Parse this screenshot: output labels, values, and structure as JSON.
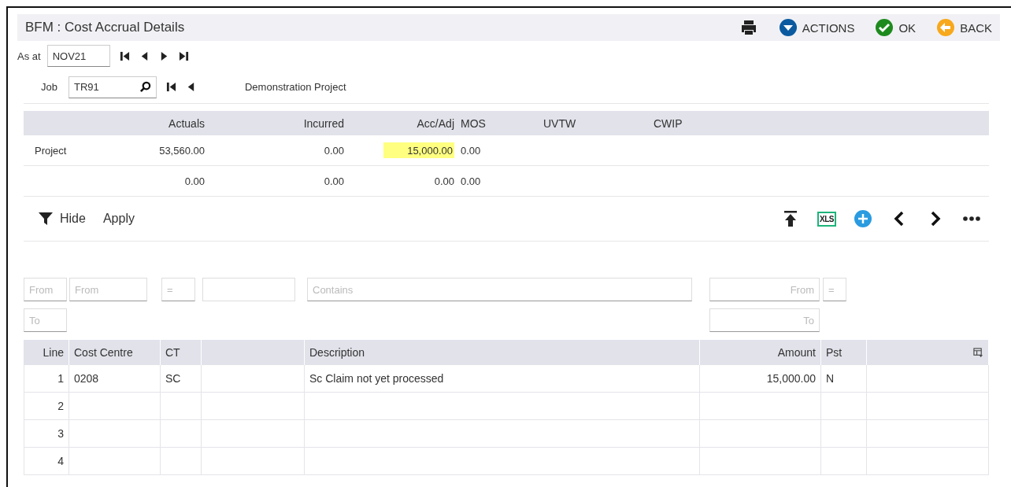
{
  "window": {
    "title": "BFM : Cost Accrual Details"
  },
  "header_actions": [
    {
      "kind": "print"
    },
    {
      "kind": "actions",
      "label": "ACTIONS"
    },
    {
      "kind": "ok",
      "label": "OK"
    },
    {
      "kind": "back",
      "label": "BACK"
    }
  ],
  "as_at": {
    "label": "As at",
    "value": "NOV21",
    "nav": [
      {
        "kind": "first"
      },
      {
        "kind": "prev"
      },
      {
        "kind": "next"
      },
      {
        "kind": "last"
      }
    ]
  },
  "job": {
    "label": "Job",
    "value": "TR91",
    "nav": [
      {
        "kind": "first"
      },
      {
        "kind": "prev"
      }
    ],
    "description": "Demonstration Project"
  },
  "summary": {
    "columns": [
      "Actuals",
      "Incurred",
      "Acc/Adj",
      "MOS",
      "UVTW",
      "CWIP"
    ],
    "rows": [
      {
        "label": "Project",
        "cells": [
          {
            "value": "53,560.00",
            "highlighted": false
          },
          {
            "value": "0.00",
            "highlighted": false
          },
          {
            "value": "15,000.00",
            "highlighted": true
          },
          {
            "value": "0.00",
            "highlighted": false
          }
        ]
      },
      {
        "cells": [
          {
            "value": "0.00",
            "highlighted": false
          },
          {
            "value": "0.00",
            "highlighted": false
          },
          {
            "value": "0.00",
            "highlighted": false
          },
          {
            "value": "0.00",
            "highlighted": false
          }
        ]
      }
    ]
  },
  "grid_toolbar": {
    "filter_toggle": "Hide",
    "apply": "Apply",
    "tools": [
      {
        "kind": "top"
      },
      {
        "kind": "xls",
        "label": "XLS"
      },
      {
        "kind": "add"
      },
      {
        "kind": "prev"
      },
      {
        "kind": "next"
      },
      {
        "kind": "more"
      }
    ]
  },
  "table": {
    "columns": [
      {
        "kind": "line",
        "label": "Line",
        "filters": [
          {
            "placeholder": "From"
          },
          {
            "placeholder": "To"
          }
        ]
      },
      {
        "kind": "text",
        "label": "Cost Centre",
        "filters": [
          {
            "placeholder": "From"
          }
        ]
      },
      {
        "kind": "text",
        "label": "CT",
        "filters": [
          {
            "placeholder": "="
          }
        ]
      },
      {
        "kind": "text",
        "filters": [
          {
            "kind": "blank"
          }
        ]
      },
      {
        "kind": "text",
        "label": "Description",
        "filters": [
          {
            "placeholder": "Contains"
          }
        ]
      },
      {
        "kind": "amount",
        "label": "Amount",
        "filters": [
          {
            "placeholder": "From"
          },
          {
            "placeholder": "To"
          }
        ]
      },
      {
        "kind": "text",
        "label": "Pst",
        "filters": [
          {
            "placeholder": "="
          }
        ]
      },
      {
        "kind": "chooser"
      }
    ],
    "rows": [
      {
        "line": "1",
        "cost_centre": "0208",
        "ct": "SC",
        "description": "Sc Claim not yet processed",
        "amount": "15,000.00",
        "pst": "N"
      },
      {
        "line": "2"
      },
      {
        "line": "3"
      },
      {
        "line": "4"
      }
    ]
  }
}
